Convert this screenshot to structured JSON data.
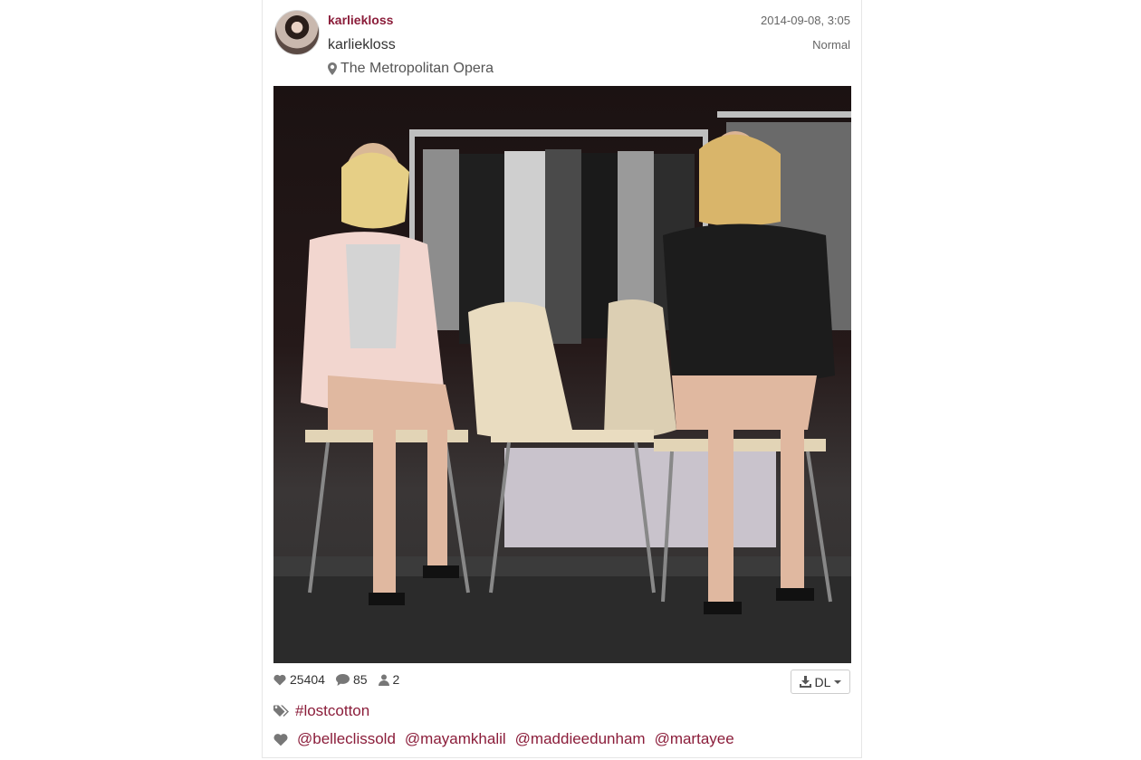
{
  "post": {
    "username": "karliekloss",
    "full_name": "karliekloss",
    "location": "The Metropolitan Opera",
    "timestamp": "2014-09-08, 3:05",
    "filter": "Normal"
  },
  "stats": {
    "likes": "25404",
    "comments": "85",
    "tagged_users": "2"
  },
  "actions": {
    "download_label": "DL"
  },
  "hashtags": [
    "#lostcotton"
  ],
  "mentions": [
    "@belleclissold",
    "@mayamkhalil",
    "@maddieedunham",
    "@martayee"
  ],
  "icons": {
    "location": "map-pin-icon",
    "likes": "heart-icon",
    "comments": "comment-icon",
    "users": "users-icon",
    "download": "download-icon",
    "tags": "tags-icon",
    "mentions": "heart-icon"
  },
  "colors": {
    "accent": "#8b1d3a",
    "muted": "#666666",
    "icon": "#777777"
  }
}
